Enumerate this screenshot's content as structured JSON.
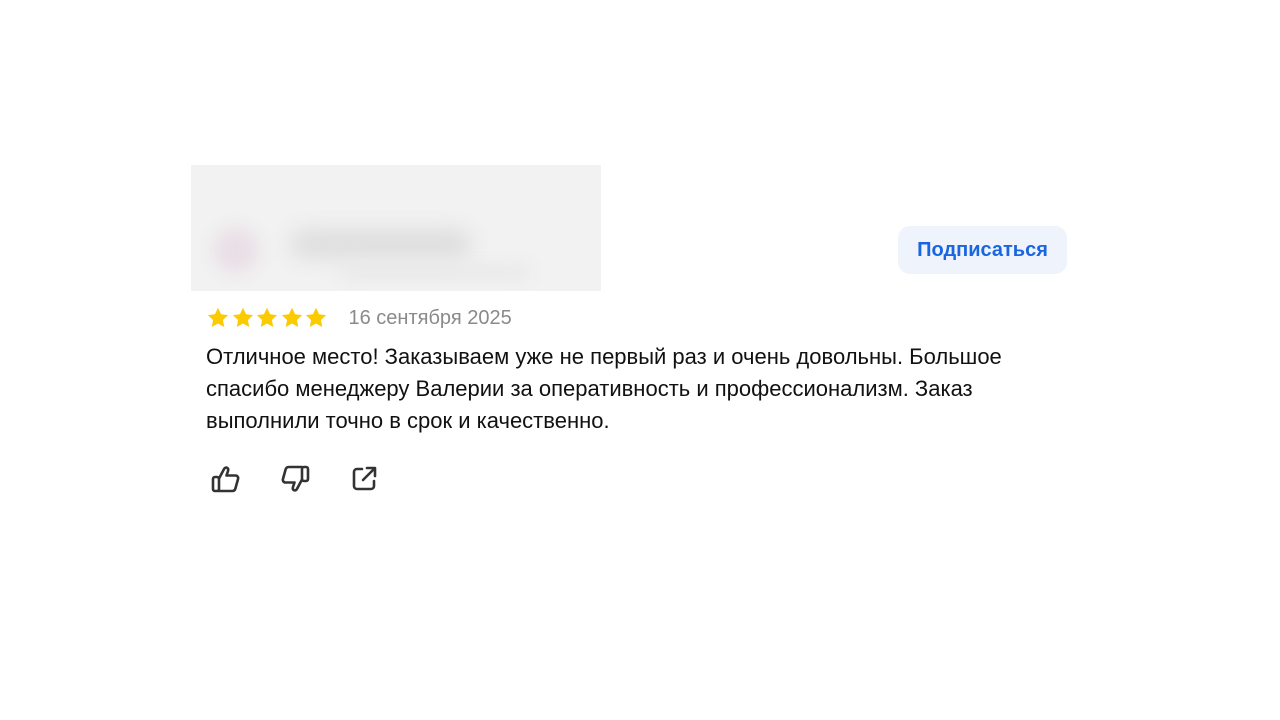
{
  "author": {
    "blurred": true
  },
  "subscribe_button": {
    "label": "Подписаться",
    "color": "#1a66e0",
    "background": "#eef3fc"
  },
  "review": {
    "rating": 5,
    "rating_max": 5,
    "star_color": "#fcca00",
    "date": "16 сентября 2025",
    "text": "Отличное место! Заказываем уже не первый раз и очень довольны. Большое спасибо менеджеру Валерии за оперативность и профессионализм. Заказ выполнили точно в срок и качественно."
  },
  "actions": [
    {
      "icon": "thumbs-up-icon"
    },
    {
      "icon": "thumbs-down-icon"
    },
    {
      "icon": "share-icon"
    }
  ]
}
